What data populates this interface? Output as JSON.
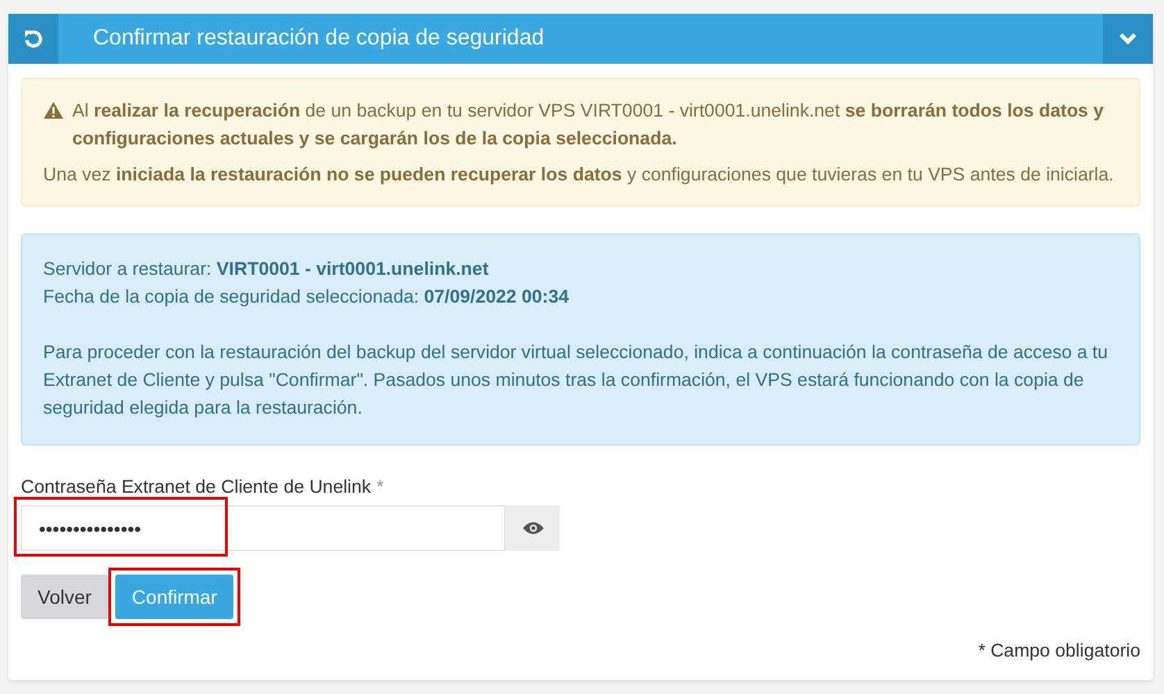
{
  "panel": {
    "title": "Confirmar restauración de copia de seguridad",
    "expanded": true
  },
  "warning": {
    "lines": [
      "Al **realizar la recuperación** de un backup en tu servidor VPS VIRT0001 - virt0001.unelink.net **se borrarán todos los datos y configuraciones actuales y se cargarán los de la copia seleccionada.**",
      "Una vez **iniciada la restauración no se pueden recuperar los datos** y configuraciones que tuvieras en tu VPS antes de iniciarla."
    ]
  },
  "info": {
    "lines": [
      "Servidor a restaurar: **VIRT0001 - virt0001.unelink.net**",
      "Fecha de la copia de seguridad seleccionada: **07/09/2022 00:34**"
    ],
    "paragraph": "Para proceder con la restauración del backup del servidor virtual seleccionado, indica a continuación la contraseña de acceso a tu Extranet de Cliente y pulsa \"Confirmar\". Pasados unos minutos tras la confirmación, el VPS estará funcionando con la copia de seguridad elegida para la restauración."
  },
  "password": {
    "label": "Contraseña Extranet de Cliente de Unelink",
    "required_mark": "*",
    "value": "•••••••••••••••",
    "highlighted": true
  },
  "buttons": [
    {
      "label": "Volver",
      "kind": "secondary",
      "highlighted": false
    },
    {
      "label": "Confirmar",
      "kind": "primary",
      "highlighted": true
    }
  ],
  "footnote": "* Campo obligatorio"
}
